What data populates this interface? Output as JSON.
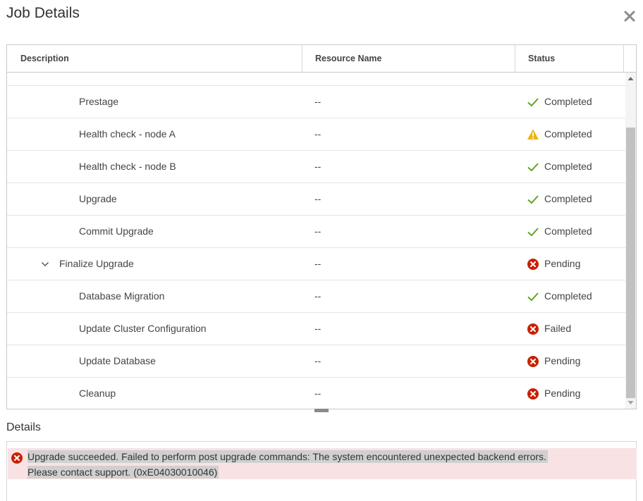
{
  "dialog": {
    "title": "Job Details",
    "close_icon": "close-icon"
  },
  "grid": {
    "columns": {
      "description": "Description",
      "resource": "Resource Name",
      "status": "Status"
    },
    "rows": [
      {
        "description": "Prestage",
        "resource": "--",
        "status": "Completed",
        "status_icon": "check-icon",
        "level": 2
      },
      {
        "description": "Health check - node A",
        "resource": "--",
        "status": "Completed",
        "status_icon": "warning-icon",
        "level": 2
      },
      {
        "description": "Health check - node B",
        "resource": "--",
        "status": "Completed",
        "status_icon": "check-icon",
        "level": 2
      },
      {
        "description": "Upgrade",
        "resource": "--",
        "status": "Completed",
        "status_icon": "check-icon",
        "level": 2
      },
      {
        "description": "Commit Upgrade",
        "resource": "--",
        "status": "Completed",
        "status_icon": "check-icon",
        "level": 2
      },
      {
        "description": "Finalize Upgrade",
        "resource": "--",
        "status": "Pending",
        "status_icon": "error-icon",
        "level": 1,
        "expanded": true
      },
      {
        "description": "Database Migration",
        "resource": "--",
        "status": "Completed",
        "status_icon": "check-icon",
        "level": 2
      },
      {
        "description": "Update Cluster Configuration",
        "resource": "--",
        "status": "Failed",
        "status_icon": "error-icon",
        "level": 2
      },
      {
        "description": "Update Database",
        "resource": "--",
        "status": "Pending",
        "status_icon": "error-icon",
        "level": 2
      },
      {
        "description": "Cleanup",
        "resource": "--",
        "status": "Pending",
        "status_icon": "error-icon",
        "level": 2
      }
    ]
  },
  "details": {
    "label": "Details",
    "alert": {
      "icon": "error-icon",
      "line1": "Upgrade succeeded. Failed to perform post upgrade commands: The system encountered unexpected backend errors.",
      "line2": "Please contact support. (0xE04030010046)"
    }
  },
  "colors": {
    "success": "#62a420",
    "warning": "#efb300",
    "danger": "#c92100",
    "alert_bg": "#f8e2e4",
    "text_highlight": "#d0d0d0"
  }
}
